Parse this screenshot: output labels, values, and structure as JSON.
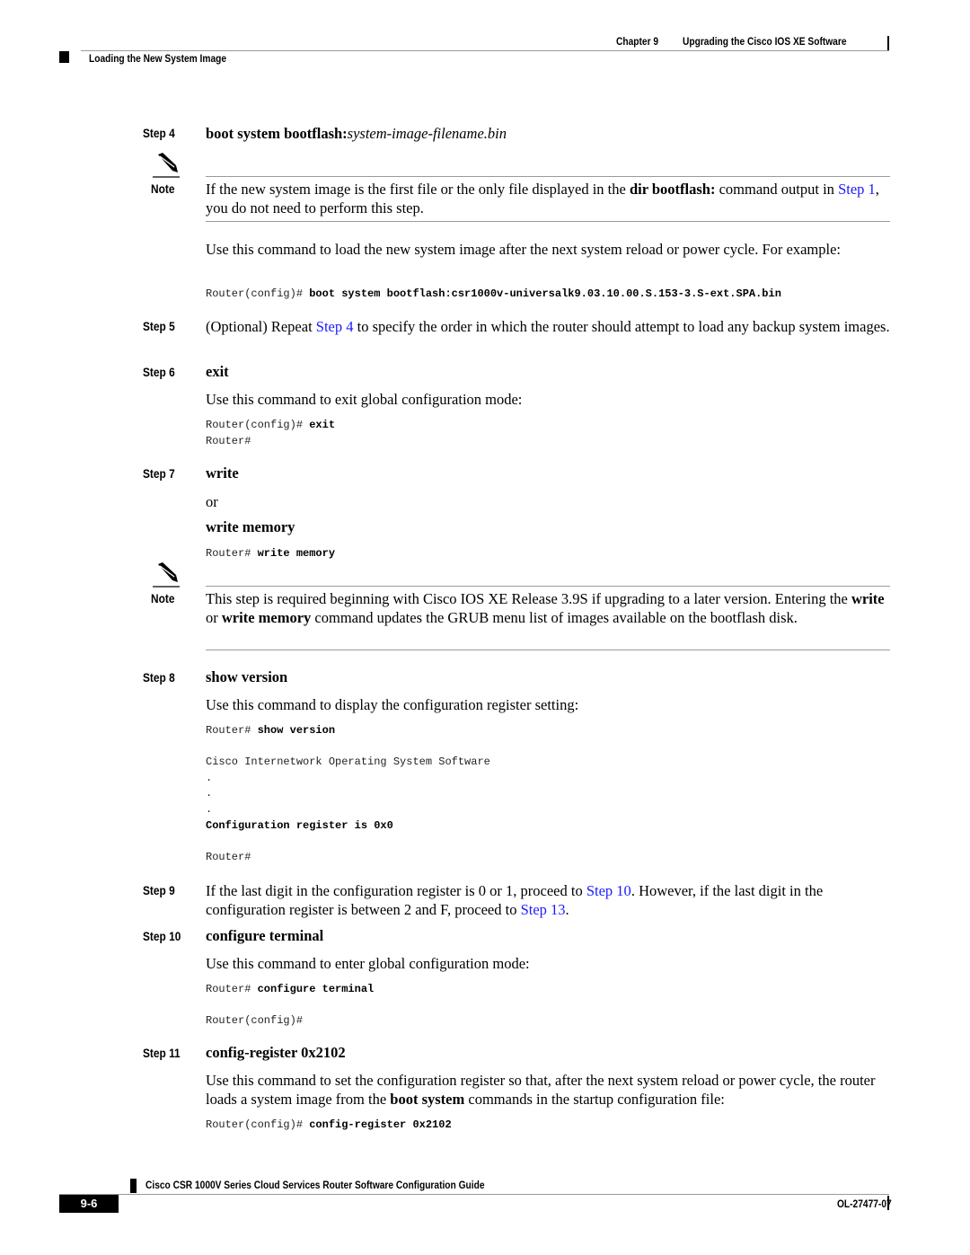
{
  "header": {
    "chapter": "Chapter 9",
    "chapter_title": "Upgrading the Cisco IOS XE Software",
    "section": "Loading the New System Image"
  },
  "steps": {
    "s4": {
      "label": "Step 4",
      "cmd_bold": "boot system bootflash:",
      "cmd_italic": "system-image-filename.bin",
      "note_label": "Note",
      "note_p1": "If the new system image is the first file or the only file displayed in the ",
      "note_bold": "dir bootflash:",
      "note_p2": " command output in ",
      "note_link": "Step 1",
      "note_p3": ", you do not need to perform this step.",
      "desc": "Use this command to load the new system image after the next system reload or power cycle. For example:",
      "code_prompt": "Router(config)# ",
      "code_cmd": "boot system bootflash:csr1000v-universalk9.03.10.00.S.153-3.S-ext.SPA.bin"
    },
    "s5": {
      "label": "Step 5",
      "p1": "(Optional) Repeat ",
      "link": "Step 4",
      "p2": " to specify the order in which the router should attempt to load any backup system images."
    },
    "s6": {
      "label": "Step 6",
      "cmd": "exit",
      "desc": "Use this command to exit global configuration mode:",
      "code_prompt": "Router(config)# ",
      "code_cmd": "exit",
      "code_line2": "Router#"
    },
    "s7": {
      "label": "Step 7",
      "cmd": "write",
      "or": "or",
      "cmd2": "write memory",
      "code_prompt": "Router# ",
      "code_cmd": "write memory",
      "note_label": "Note",
      "note_p1": "This step is required beginning with Cisco IOS XE Release 3.9S if upgrading to a later version. Entering the ",
      "note_b1": "write",
      "note_p2": " or ",
      "note_b2": "write memory",
      "note_p3": " command updates the GRUB menu list of images available on the bootflash disk."
    },
    "s8": {
      "label": "Step 8",
      "cmd": "show version",
      "desc": "Use this command to display the configuration register setting:",
      "code_prompt": "Router# ",
      "code_cmd": "show version",
      "out1": "Cisco Internetwork Operating System Software",
      "dot": ".",
      "out_bold": "Configuration register is 0x0",
      "out_end": "Router#"
    },
    "s9": {
      "label": "Step 9",
      "p1": "If the last digit in the configuration register is 0 or 1, proceed to ",
      "link1": "Step 10",
      "p2": ". However, if the last digit in the configuration register is between 2 and F, proceed to ",
      "link2": "Step 13",
      "p3": "."
    },
    "s10": {
      "label": "Step 10",
      "cmd": "configure terminal",
      "desc": "Use this command to enter global configuration mode:",
      "code_prompt": "Router# ",
      "code_cmd": "configure terminal",
      "code_line2": "Router(config)#"
    },
    "s11": {
      "label": "Step 11",
      "cmd": "config-register 0x2102",
      "p1": "Use this command to set the configuration register so that, after the next system reload or power cycle, the router loads a system image from the ",
      "bold": "boot system",
      "p2": " commands in the startup configuration file:",
      "code_prompt": "Router(config)# ",
      "code_cmd": "config-register 0x2102"
    }
  },
  "footer": {
    "guide_title": "Cisco CSR 1000V Series Cloud Services Router Software Configuration Guide",
    "page_number": "9-6",
    "doc_id": "OL-27477-07"
  }
}
